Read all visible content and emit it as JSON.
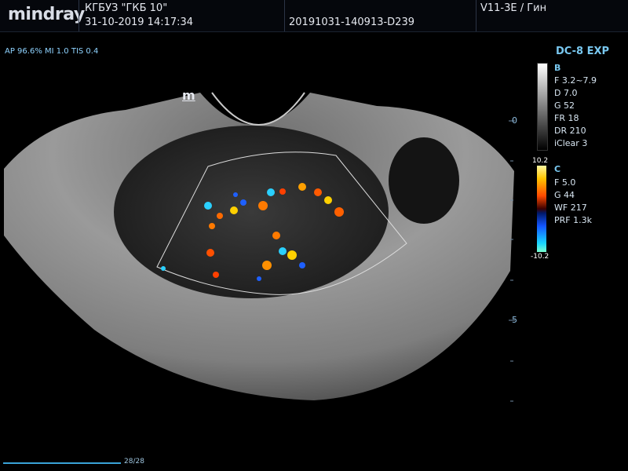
{
  "header": {
    "brand": "mindray",
    "hospital": "КГБУЗ \"ГКБ 10\"",
    "date_time": "31-10-2019  14:17:34",
    "study_id": "20191031-140913-D239",
    "probe_mode": "V11-3E / Гин"
  },
  "acoustic_output": "AP 96.6%  MI 1.0  TIS 0.4",
  "preset": "DC-8 EXP",
  "bmode": {
    "label": "B",
    "params": [
      "F 3.2~7.9",
      "D 7.0",
      "G 52",
      "FR 18",
      "DR 210",
      "iClear 3"
    ]
  },
  "color": {
    "label": "C",
    "scale_max": "10.2",
    "scale_min": "-10.2",
    "params": [
      "F 5.0",
      "G 44",
      "WF 217",
      "PRF 1.3k"
    ]
  },
  "depth_marks": [
    "0",
    "5"
  ],
  "cine": "28/28",
  "marker": "m"
}
